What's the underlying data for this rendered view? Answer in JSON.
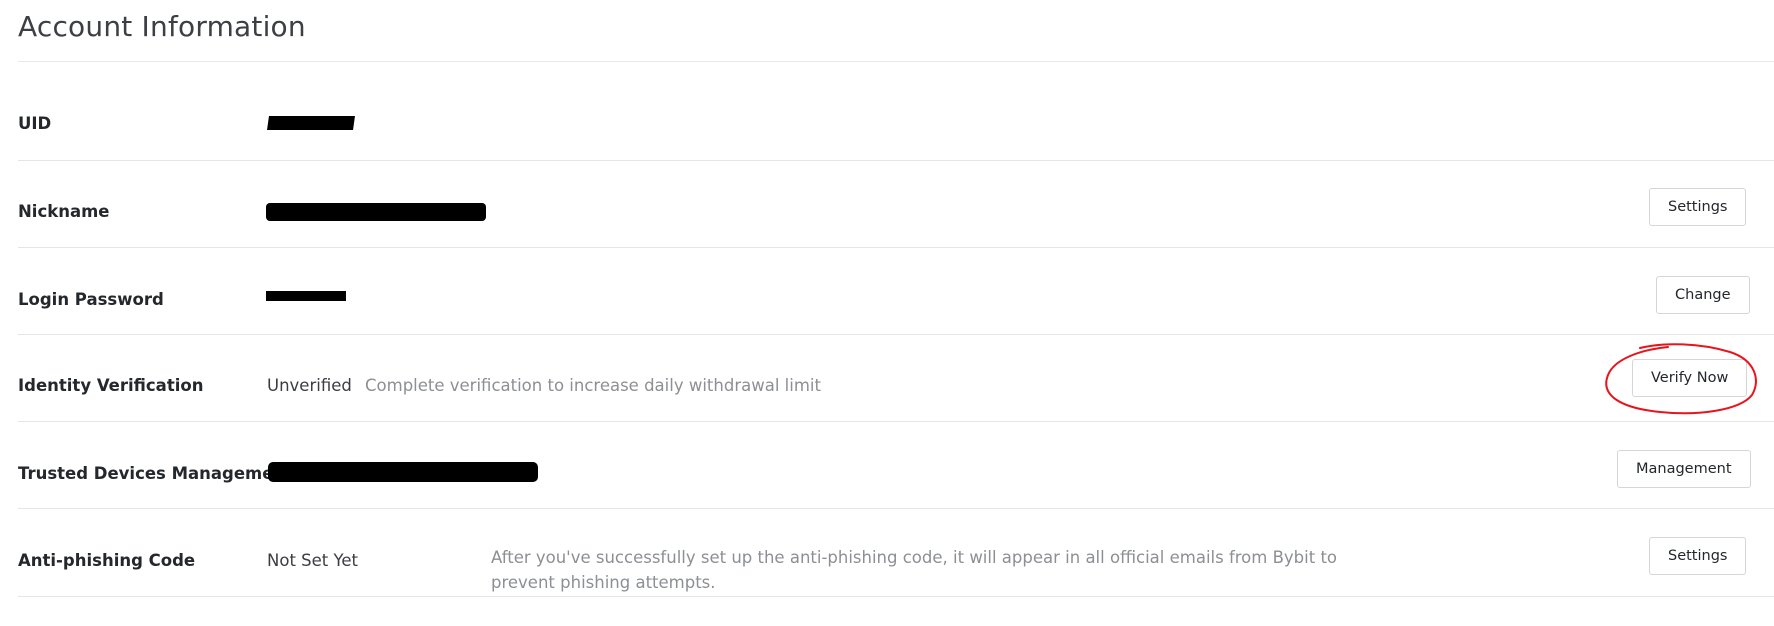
{
  "header": {
    "title": "Account Information"
  },
  "rows": {
    "uid": {
      "label": "UID"
    },
    "nickname": {
      "label": "Nickname",
      "button": "Settings"
    },
    "password": {
      "label": "Login Password",
      "button": "Change"
    },
    "identity": {
      "label": "Identity Verification",
      "value": "Unverified",
      "description": "Complete verification to increase daily withdrawal limit",
      "button": "Verify Now"
    },
    "devices": {
      "label": "Trusted Devices Management",
      "button": "Management"
    },
    "antiphishing": {
      "label": "Anti-phishing Code",
      "value": "Not Set Yet",
      "description": "After you've successfully set up the anti-phishing code, it will appear in all official emails from Bybit to prevent phishing attempts.",
      "button": "Settings"
    }
  },
  "colors": {
    "annotation_circle": "#e8141c",
    "redaction": "#000000"
  }
}
